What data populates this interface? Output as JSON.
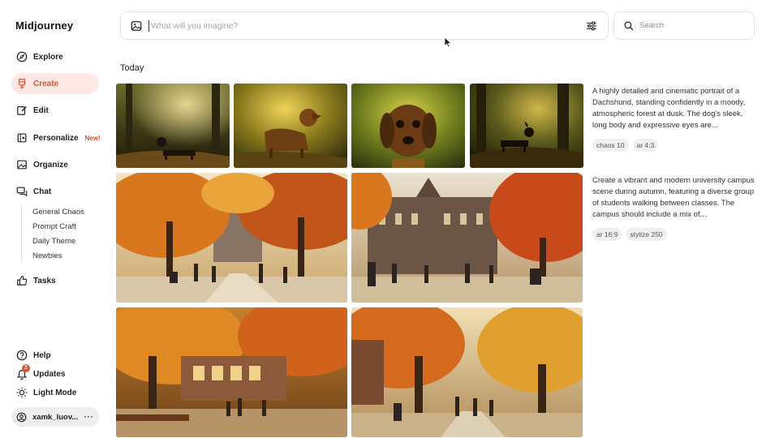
{
  "brand": "Midjourney",
  "nav": {
    "explore": "Explore",
    "create": "Create",
    "edit": "Edit",
    "personalize": "Personalize",
    "personalize_badge": "New!",
    "organize": "Organize",
    "chat": "Chat",
    "chat_rooms": [
      "General Chaos",
      "Prompt Craft",
      "Daily Theme",
      "Newbies"
    ],
    "tasks": "Tasks",
    "help": "Help",
    "updates": "Updates",
    "updates_count": "2",
    "light_mode": "Light Mode",
    "user": "xamk_luov..."
  },
  "prompt": {
    "placeholder": "What will you imagine?",
    "value": ""
  },
  "search": {
    "placeholder": "Search"
  },
  "feed": {
    "section_title": "Today",
    "jobs": [
      {
        "description": "A highly detailed and cinematic portrait of a Dachshund, standing confidently in a moody, atmospheric forest at dusk. The dog's sleek, long body and expressive eyes are...",
        "tags": [
          "chaos 10",
          "ar 4:3"
        ]
      },
      {
        "description": "Create a vibrant and modern university campus scene during autumn, featuring a diverse group of students walking between classes. The campus should include a mix of...",
        "tags": [
          "ar 16:9",
          "stylize 250"
        ]
      }
    ]
  },
  "colors": {
    "accent": "#e0502f",
    "active_bg": "#fde8e3",
    "autumn_orange": "#d9771f",
    "forest_gold": "#c8961e"
  }
}
